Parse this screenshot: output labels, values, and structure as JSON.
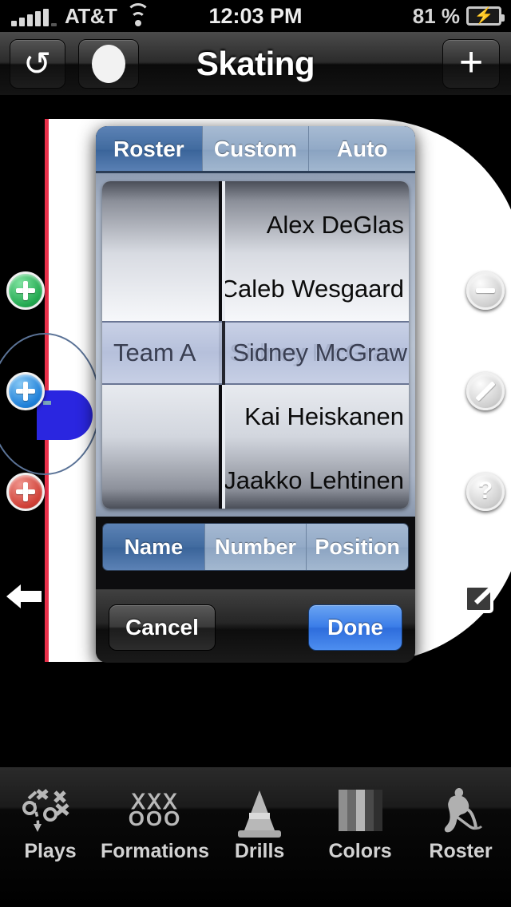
{
  "status_bar": {
    "carrier": "AT&T",
    "time": "12:03 PM",
    "battery_percent": "81 %",
    "signal_icon": "signal-bars-icon",
    "wifi_icon": "wifi-icon",
    "battery_icon": "battery-charging-icon"
  },
  "nav_bar": {
    "title": "Skating",
    "refresh_icon": "redo-icon",
    "record_icon": "record-dot-icon",
    "add_icon": "plus-icon"
  },
  "canvas_tools": {
    "add_green": "+",
    "add_blue": "+",
    "add_red": "+",
    "minus": "−",
    "line": "line-icon",
    "help": "?",
    "back_icon": "back-arrow-icon",
    "export_icon": "export-icon"
  },
  "colors": {
    "rink_ice": "#ffffff",
    "goal_line_red": "#e8304a",
    "crease_blue": "#2a26e0",
    "faceoff_line": "#5b7397",
    "tab_active_blue": "#416b9f",
    "tab_inactive_blue": "#93aac7",
    "done_button_blue": "#3b7de8",
    "add_green": "#22a84f",
    "add_blue": "#1e7fd8",
    "add_red": "#cf3f36"
  },
  "modal": {
    "tabs": [
      {
        "label": "Roster",
        "active": true
      },
      {
        "label": "Custom",
        "active": false
      },
      {
        "label": "Auto",
        "active": false
      }
    ],
    "picker": {
      "team_column": {
        "visible_items": [
          "",
          "",
          "Team A",
          "",
          ""
        ],
        "selected": "Team A"
      },
      "name_column": {
        "visible_items": [
          "Alex DeGlas",
          "Caleb Wesgaard",
          "Sidney McGraw",
          "Kai Heiskanen",
          "Jaakko Lehtinen"
        ],
        "selected": "Sidney McGraw"
      }
    },
    "segmented": [
      {
        "label": "Name",
        "active": true
      },
      {
        "label": "Number",
        "active": false
      },
      {
        "label": "Position",
        "active": false
      }
    ],
    "cancel_label": "Cancel",
    "done_label": "Done"
  },
  "bottom_tabs": [
    {
      "label": "Plays",
      "icon": "plays-diagram-icon",
      "active": false
    },
    {
      "label": "Formations",
      "icon": "formations-xo-icon",
      "active": false
    },
    {
      "label": "Drills",
      "icon": "cone-icon",
      "active": false
    },
    {
      "label": "Colors",
      "icon": "color-bars-icon",
      "active": false
    },
    {
      "label": "Roster",
      "icon": "hockey-player-icon",
      "active": false
    }
  ]
}
